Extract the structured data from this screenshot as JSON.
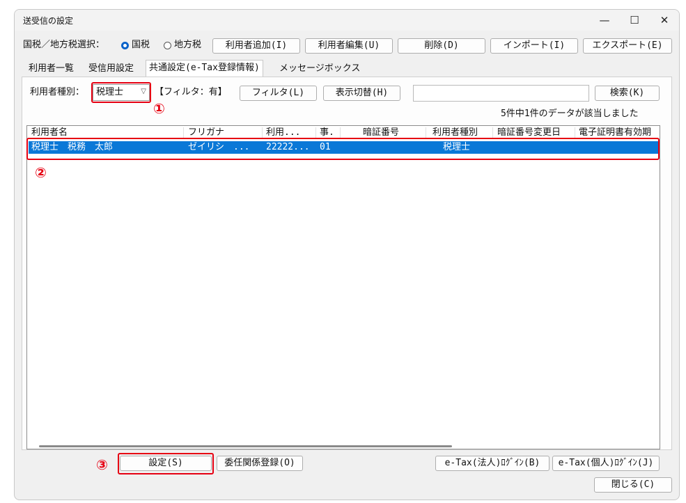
{
  "window": {
    "title": "送受信の設定",
    "controls": {
      "minimize": "—",
      "maximize": "☐",
      "close": "✕"
    }
  },
  "toolbar": {
    "tax_select_label": "国税／地方税選択：",
    "radio_national": "国税",
    "radio_local": "地方税",
    "selected": "国税",
    "add_user_button": "利用者追加(I)",
    "edit_user_button": "利用者編集(U)",
    "delete_button": "削除(D)",
    "import_button": "インポート(I)",
    "export_button": "エクスポート(E)"
  },
  "tabs": [
    {
      "label": "利用者一覧"
    },
    {
      "label": "受信用設定"
    },
    {
      "label": "共通設定(e-Tax登録情報)",
      "active": true
    },
    {
      "label": "メッセージボックス"
    }
  ],
  "filter": {
    "user_type_label": "利用者種別：",
    "user_type_value": "税理士",
    "filter_status": "【フィルタ：有】",
    "filter_button": "フィルタ(L)",
    "toggle_display_button": "表示切替(H)",
    "search_text": "",
    "search_button": "検索(K)",
    "result_count": "5件中1件のデータが該当しました"
  },
  "list": {
    "columns": [
      "利用者名",
      "フリガナ",
      "利用...",
      "事.",
      "暗証番号",
      "利用者種別",
      "暗証番号変更日",
      "電子証明書有効期"
    ],
    "rows": [
      {
        "name": "税理士　税務　太郎",
        "kana": "ゼイリシ　...",
        "id": "22222...",
        "office": "01",
        "pin": "",
        "user_type": "税理士",
        "pin_changed": "",
        "cert_expiry": ""
      }
    ]
  },
  "footer": {
    "settings_button": "設定(S)",
    "delegation_button": "委任関係登録(O)",
    "etax_corp_login": "e-Tax(法人)ﾛｸﾞｲﾝ(B)",
    "etax_personal_login": "e-Tax(個人)ﾛｸﾞｲﾝ(J)",
    "close_button": "閉じる(C)"
  },
  "annotations": {
    "marker1": "①",
    "marker2": "②",
    "marker3": "③",
    "color": "#e60012"
  },
  "colors": {
    "selection": "#0a78d7",
    "radio_accent": "#0b63c9"
  }
}
